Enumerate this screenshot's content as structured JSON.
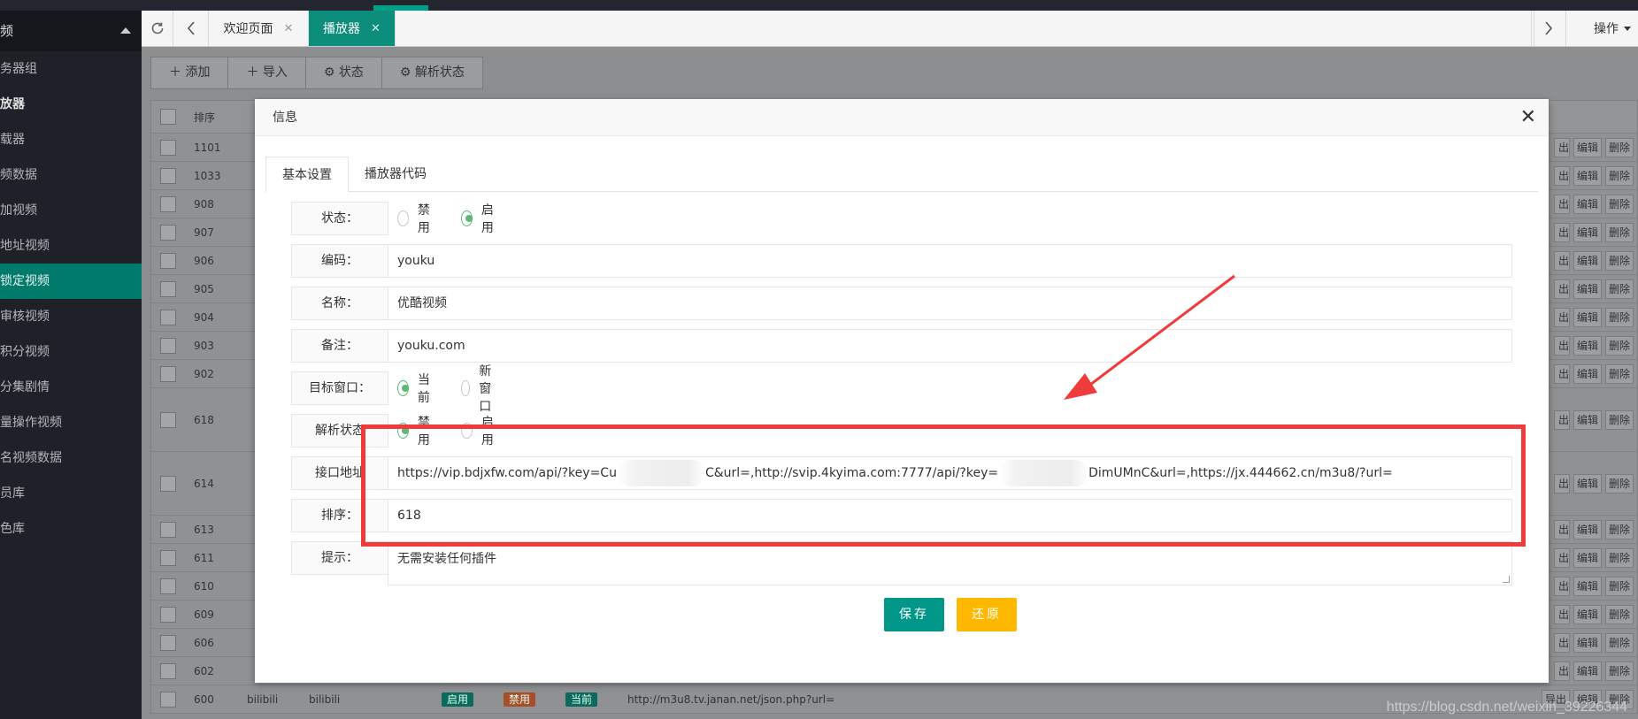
{
  "sidebar": {
    "header": "频",
    "items": [
      {
        "label": "务器组",
        "active": false,
        "bold": false
      },
      {
        "label": "放器",
        "active": false,
        "bold": true
      },
      {
        "label": "载器",
        "active": false,
        "bold": false
      },
      {
        "label": "频数据",
        "active": false,
        "bold": false
      },
      {
        "label": "加视频",
        "active": false,
        "bold": false
      },
      {
        "label": "地址视频",
        "active": false,
        "bold": false
      },
      {
        "label": "锁定视频",
        "active": true,
        "bold": false
      },
      {
        "label": "审核视频",
        "active": false,
        "bold": false
      },
      {
        "label": "积分视频",
        "active": false,
        "bold": false
      },
      {
        "label": "分集剧情",
        "active": false,
        "bold": false
      },
      {
        "label": "量操作视频",
        "active": false,
        "bold": false
      },
      {
        "label": "名视频数据",
        "active": false,
        "bold": false
      },
      {
        "label": "员库",
        "active": false,
        "bold": false
      },
      {
        "label": "色库",
        "active": false,
        "bold": false
      }
    ]
  },
  "tabbar": {
    "tab_welcome": "欢迎页面",
    "tab_player": "播放器",
    "close_glyph": "✕",
    "operations": "操作"
  },
  "toolbar": {
    "add": "添加",
    "import": "导入",
    "status": "状态",
    "parse_status": "解析状态"
  },
  "bgtable": {
    "header_sort": "排序",
    "rows": [
      {
        "sort": "1101",
        "tall": false
      },
      {
        "sort": "1033",
        "tall": false
      },
      {
        "sort": "908",
        "tall": false
      },
      {
        "sort": "907",
        "tall": false
      },
      {
        "sort": "906",
        "tall": false
      },
      {
        "sort": "905",
        "tall": false
      },
      {
        "sort": "904",
        "tall": false
      },
      {
        "sort": "903",
        "tall": false
      },
      {
        "sort": "902",
        "tall": false
      },
      {
        "sort": "618",
        "tall": true
      },
      {
        "sort": "614",
        "tall": true
      },
      {
        "sort": "613",
        "tall": false
      },
      {
        "sort": "611",
        "tall": false
      },
      {
        "sort": "610",
        "tall": false
      },
      {
        "sort": "609",
        "tall": false
      },
      {
        "sort": "606",
        "tall": false
      },
      {
        "sort": "602",
        "tall": false
      }
    ],
    "last_row": {
      "sort": "600",
      "code": "bilibili",
      "name": "bilibili",
      "status_tag": "启用",
      "parse_tag": "禁用",
      "target_tag": "当前",
      "url": "http://m3u8.tv.janan.net/json.php?url=",
      "export": "导出"
    },
    "op_out": "出",
    "op_edit": "编辑",
    "op_delete": "删除"
  },
  "modal": {
    "title": "信息",
    "close": "✕",
    "tabs": [
      "基本设置",
      "播放器代码"
    ],
    "fields": {
      "status_label": "状态：",
      "status_opt_disable": "禁用",
      "status_opt_enable": "启用",
      "code_label": "编码：",
      "code_value": "youku",
      "name_label": "名称：",
      "name_value": "优酷视频",
      "remark_label": "备注：",
      "remark_value": "youku.com",
      "target_label": "目标窗口：",
      "target_opt_current": "当前",
      "target_opt_new": "新窗口",
      "parse_label": "解析状态",
      "parse_opt_disable": "禁用",
      "parse_opt_enable": "启用",
      "api_label": "接口地址",
      "api_value_part1": "https://vip.bdjxfw.com/api/?key=Cu",
      "api_value_part2": "C&url=,http://svip.4kyima.com:7777/api/?key=",
      "api_value_part3": "DimUMnC&url=,https://jx.444662.cn/m3u8/?url=",
      "sort_label": "排序：",
      "sort_value": "618",
      "tip_label": "提示：",
      "tip_value": "无需安装任何插件"
    },
    "save": "保存",
    "reset": "还原"
  },
  "watermark": "https://blog.csdn.net/weixin_39226344",
  "colors": {
    "primary": "#009688",
    "warning": "#ffb800",
    "highlight": "#f03b3b",
    "radio_on": "#5fb878"
  }
}
